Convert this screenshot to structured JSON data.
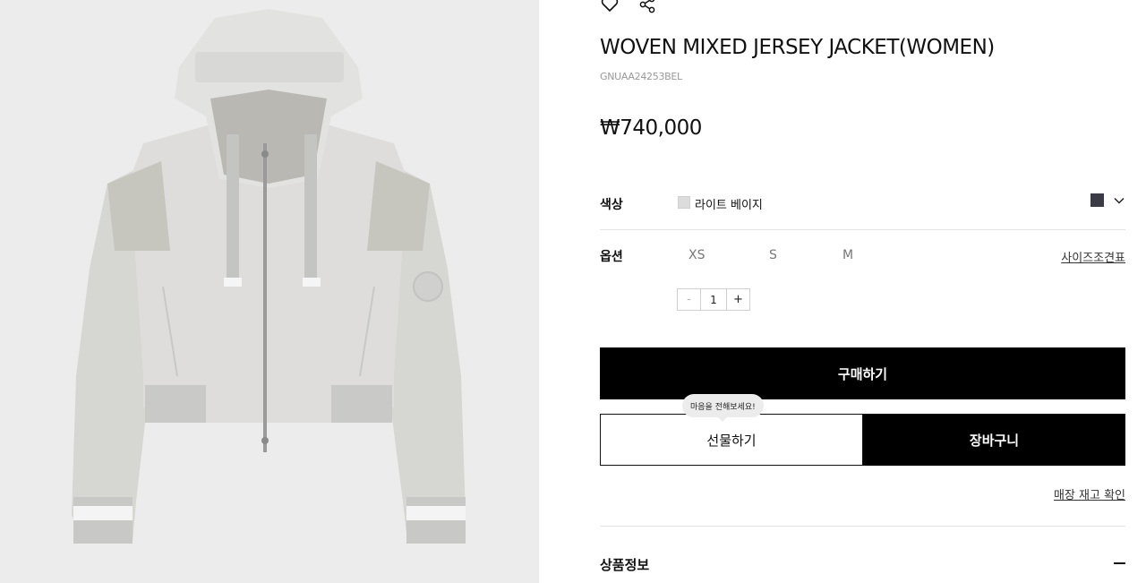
{
  "product": {
    "title": "WOVEN MIXED JERSEY JACKET(WOMEN)",
    "code": "GNUAA24253BEL",
    "price": "₩740,000",
    "image_alt": "jacket-product-photo"
  },
  "icons": {
    "wishlist": "heart-icon",
    "share": "share-icon",
    "dropdown": "chevron-down-icon"
  },
  "options": {
    "color_label": "색상",
    "color_name": "라이트 베이지",
    "color_swatch": "#dcdcdc",
    "selected_chip_color": "#3a3b44",
    "option_label": "옵션",
    "sizes": [
      "XS",
      "S",
      "M"
    ],
    "size_chart": "사이즈조견표"
  },
  "quantity": {
    "minus": "-",
    "value": "1",
    "plus": "+"
  },
  "actions": {
    "buy": "구매하기",
    "gift": "선물하기",
    "gift_tooltip": "마음을 전해보세요!",
    "cart": "장바구니",
    "stock_check": "매장 재고 확인"
  },
  "accordion": {
    "product_info": "상품정보"
  },
  "colors": {
    "primary_button": "#000000",
    "image_background": "#ececec"
  }
}
